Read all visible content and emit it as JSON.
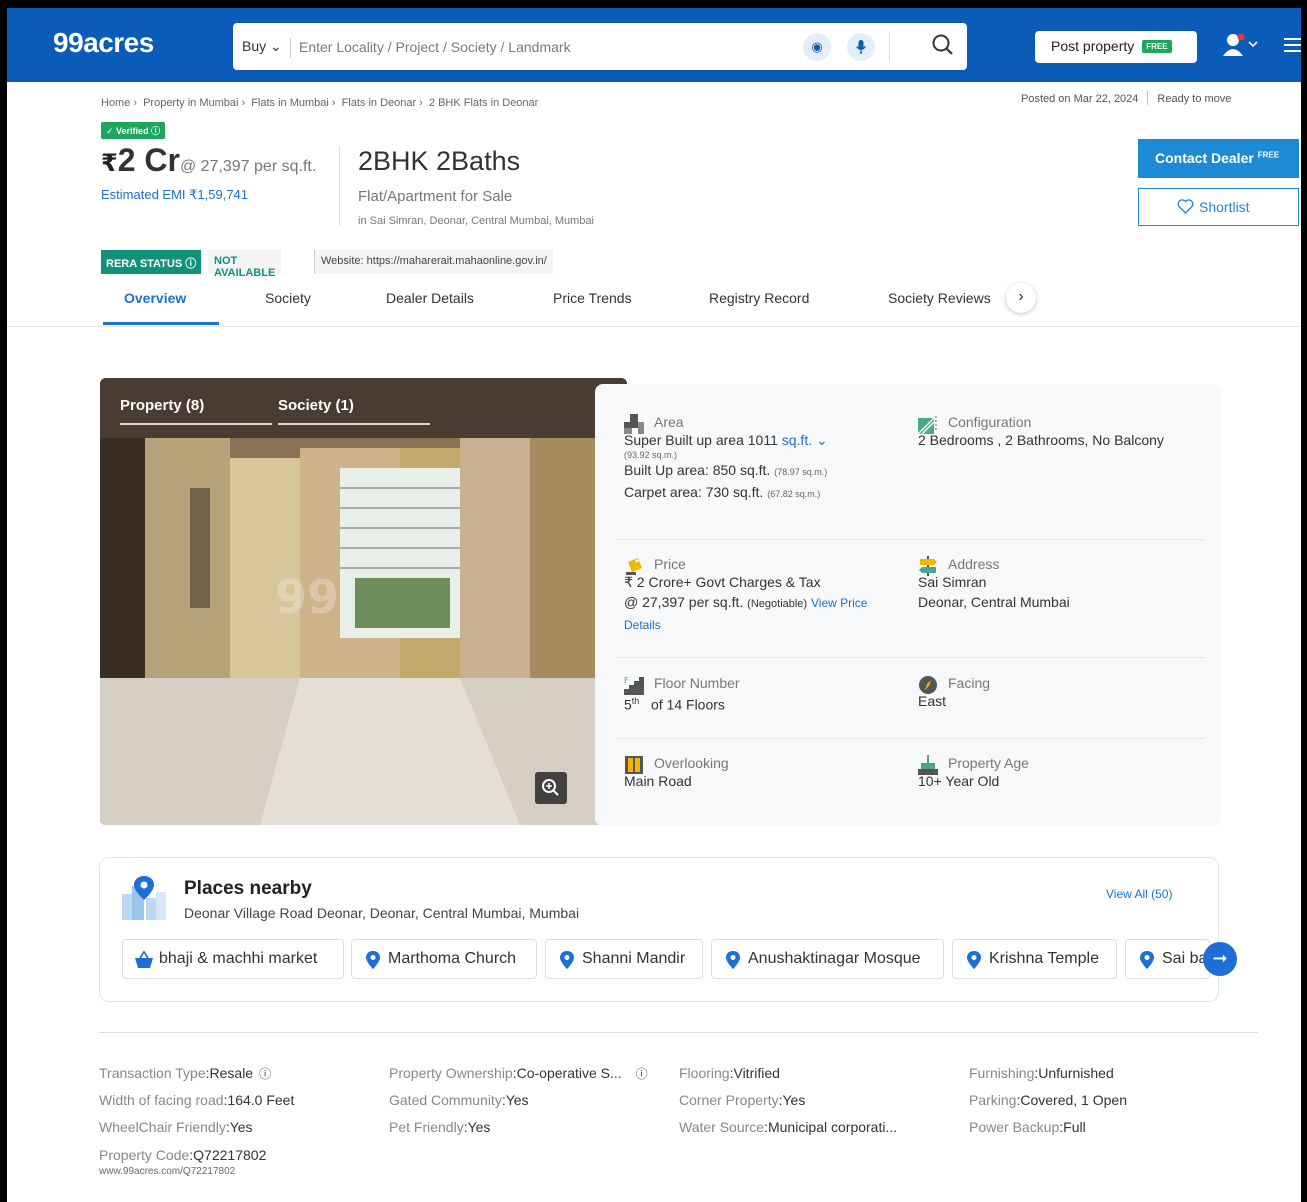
{
  "header": {
    "logo": "99acres",
    "search_mode": "Buy",
    "search_placeholder": "Enter Locality / Project / Society / Landmark",
    "post_property": "Post property",
    "free_badge": "FREE"
  },
  "colors": {
    "brand": "#0a5cb8",
    "accent": "#1d8ad6",
    "green": "#1ea65e",
    "rera": "#11917a"
  },
  "breadcrumb": [
    "Home",
    "Property in Mumbai",
    "Flats in Mumbai",
    "Flats in Deonar",
    "2 BHK Flats in Deonar"
  ],
  "posted": "Posted on Mar 22, 2024",
  "status": "Ready to move",
  "verified": "Verified",
  "price": {
    "rupee": "₹",
    "amount": "2 Cr",
    "per_sqft": "@ 27,397 per sq.ft.",
    "emi": "Estimated EMI ₹1,59,741"
  },
  "listing": {
    "title": "2BHK 2Baths",
    "subtitle": "Flat/Apartment for Sale",
    "location": "in Sai Simran, Deonar, Central Mumbai, Mumbai"
  },
  "actions": {
    "contact": "Contact Dealer",
    "contact_badge": "FREE",
    "shortlist": "Shortlist"
  },
  "rera": {
    "label": "RERA STATUS",
    "value": "NOT AVAILABLE",
    "website": "Website: https://maharerait.mahaonline.gov.in/"
  },
  "tabs": [
    "Overview",
    "Society",
    "Dealer Details",
    "Price Trends",
    "Registry Record",
    "Society Reviews"
  ],
  "photo": {
    "tab_property": "Property (8)",
    "tab_society": "Society (1)",
    "watermark": "99"
  },
  "details": {
    "area_label": "Area",
    "area_super": "Super Built up area 1011",
    "area_unit": "sq.ft.",
    "area_super_sqm": "(93.92 sq.m.)",
    "area_built": "Built Up area: 850 sq.ft.",
    "area_built_sqm": "(78.97 sq.m.)",
    "area_carpet": "Carpet area: 730 sq.ft.",
    "area_carpet_sqm": "(67.82 sq.m.)",
    "config_label": "Configuration",
    "config_value": "2 Bedrooms , 2 Bathrooms, No Balcony",
    "price_label": "Price",
    "price_value": "₹ 2 Crore+ Govt Charges & Tax",
    "price_sqft": "@ 27,397 per sq.ft.",
    "price_neg": "(Negotiable)",
    "price_link": "View Price Details",
    "address_label": "Address",
    "address_line1": "Sai Simran",
    "address_line2": "Deonar, Central Mumbai",
    "floor_label": "Floor Number",
    "floor_num": "5",
    "floor_sup": "th",
    "floor_of": "of 14 Floors",
    "facing_label": "Facing",
    "facing_value": "East",
    "overlooking_label": "Overlooking",
    "overlooking_value": "Main Road",
    "age_label": "Property Age",
    "age_value": "10+ Year Old"
  },
  "places": {
    "title": "Places nearby",
    "address": "Deonar Village Road Deonar, Deonar, Central Mumbai, Mumbai",
    "view_all": "View All (50)",
    "chips": [
      "bhaji & machhi market",
      "Marthoma Church",
      "Shanni Mandir",
      "Anushaktinagar Mosque",
      "Krishna Temple",
      "Sai ba"
    ]
  },
  "attributes": {
    "transaction_label": "Transaction Type",
    "transaction_value": "Resale",
    "ownership_label": "Property Ownership",
    "ownership_value": "Co-operative S...",
    "flooring_label": "Flooring",
    "flooring_value": "Vitrified",
    "furnishing_label": "Furnishing",
    "furnishing_value": "Unfurnished",
    "road_label": "Width of facing road",
    "road_value": "164.0 Feet",
    "gated_label": "Gated Community",
    "gated_value": "Yes",
    "corner_label": "Corner Property",
    "corner_value": "Yes",
    "parking_label": "Parking",
    "parking_value": "Covered, 1 Open",
    "wheelchair_label": "WheelChair Friendly",
    "wheelchair_value": "Yes",
    "pet_label": "Pet Friendly",
    "pet_value": "Yes",
    "water_label": "Water Source",
    "water_value": "Municipal corporati...",
    "backup_label": "Power Backup",
    "backup_value": "Full",
    "code_label": "Property Code",
    "code_value": "Q72217802",
    "code_url": "www.99acres.com/Q72217802"
  }
}
